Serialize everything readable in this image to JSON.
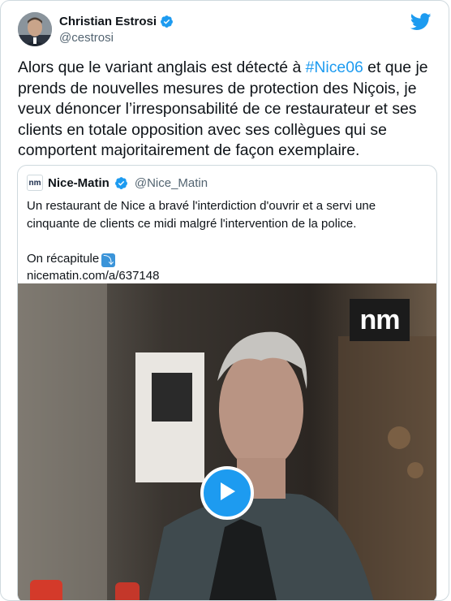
{
  "author": {
    "display_name": "Christian Estrosi",
    "handle": "@cestrosi",
    "verified": true
  },
  "tweet": {
    "text_before": "Alors que le variant anglais est détecté à ",
    "hashtag": "#Nice06",
    "text_after": " et que je prends de nouvelles mesures de protection des Niçois, je veux dénoncer l’irresponsabilité de ce restaurateur et ses clients en totale opposition avec ses collègues qui se comportent majoritairement de façon exemplaire."
  },
  "quoted_tweet": {
    "logo_text": "nm",
    "display_name": "Nice-Matin",
    "handle": "@Nice_Matin",
    "verified": true,
    "body": "Un restaurant de Nice a bravé l'interdiction d'ouvrir et a servi une cinquante de clients ce midi malgré l'intervention de la police.",
    "recap_label": "On récapitule",
    "recap_emoji": "⤵",
    "link": "nicematin.com/a/637148",
    "media": {
      "watermark": "nm",
      "type": "video"
    }
  },
  "colors": {
    "accent": "#1d9bf0",
    "text": "#0f1419",
    "secondary": "#536471",
    "border": "#cfd9de"
  },
  "icons": [
    "verified-badge-icon",
    "twitter-bird-icon",
    "play-icon",
    "arrow-down-right-emoji-icon"
  ]
}
